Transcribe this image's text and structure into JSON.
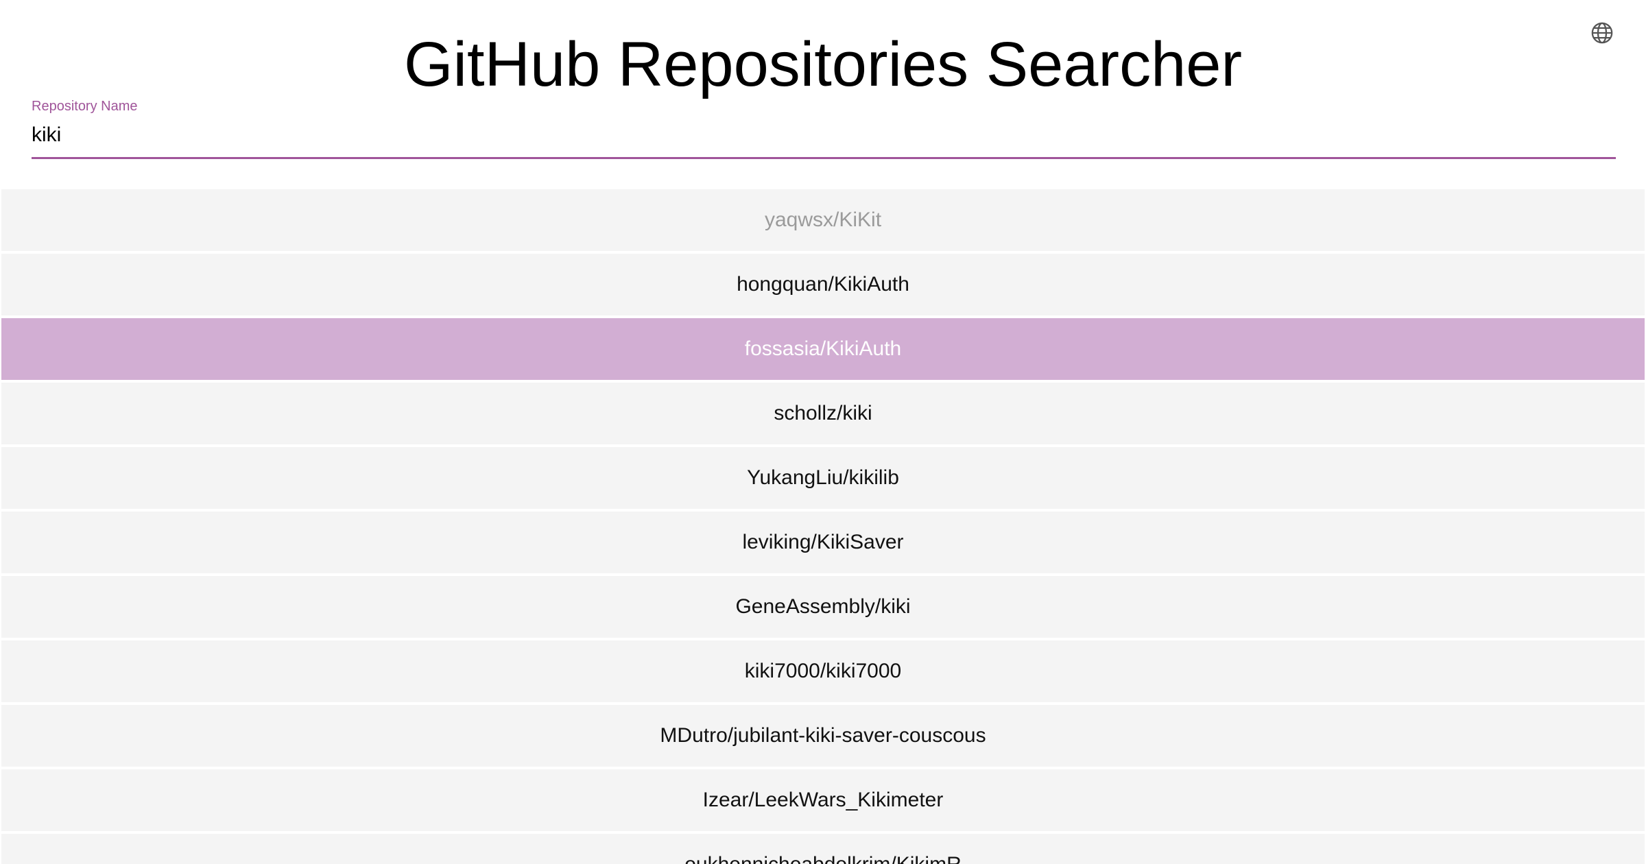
{
  "app": {
    "title": "GitHub Repositories Searcher"
  },
  "header": {
    "language_icon": "globe-icon"
  },
  "search": {
    "label": "Repository Name",
    "value": "kiki",
    "placeholder": ""
  },
  "colors": {
    "accent": "#a0559a",
    "selected_row": "#d2aed3",
    "row_background": "#f4f4f4"
  },
  "results": [
    {
      "name": "yaqwsx/KiKit",
      "state": "faded"
    },
    {
      "name": "hongquan/KikiAuth",
      "state": "normal"
    },
    {
      "name": "fossasia/KikiAuth",
      "state": "selected"
    },
    {
      "name": "schollz/kiki",
      "state": "normal"
    },
    {
      "name": "YukangLiu/kikilib",
      "state": "normal"
    },
    {
      "name": "leviking/KikiSaver",
      "state": "normal"
    },
    {
      "name": "GeneAssembly/kiki",
      "state": "normal"
    },
    {
      "name": "kiki7000/kiki7000",
      "state": "normal"
    },
    {
      "name": "MDutro/jubilant-kiki-saver-couscous",
      "state": "normal"
    },
    {
      "name": "Izear/LeekWars_Kikimeter",
      "state": "normal"
    },
    {
      "name": "oukhennicheabdelkrim/KikimR",
      "state": "normal"
    }
  ]
}
